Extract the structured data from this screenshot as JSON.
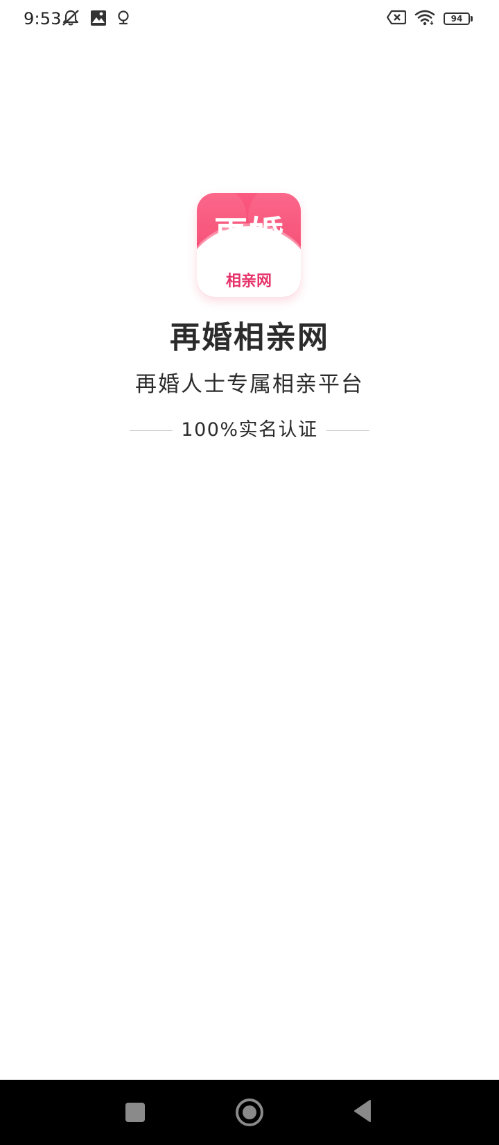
{
  "status_bar": {
    "time": "9:53",
    "left_icons": [
      "muted-bell-icon",
      "photo-icon",
      "location-icon"
    ],
    "right_icons": [
      "no-sim-icon",
      "wifi-icon",
      "battery-icon"
    ],
    "battery_level": "94"
  },
  "splash": {
    "logo": {
      "main_text": "再婚",
      "sub_text": "相亲网",
      "gradient_start": "#fb5a80",
      "gradient_end": "#f2315d",
      "sub_text_color": "#e6336a"
    },
    "app_name": "再婚相亲网",
    "tagline": "再婚人士专属相亲平台",
    "verification": "100%实名认证"
  },
  "nav_bar": {
    "buttons": [
      "recents-icon",
      "home-icon",
      "back-icon"
    ],
    "background": "#000000",
    "icon_color": "#8a8a8a"
  }
}
